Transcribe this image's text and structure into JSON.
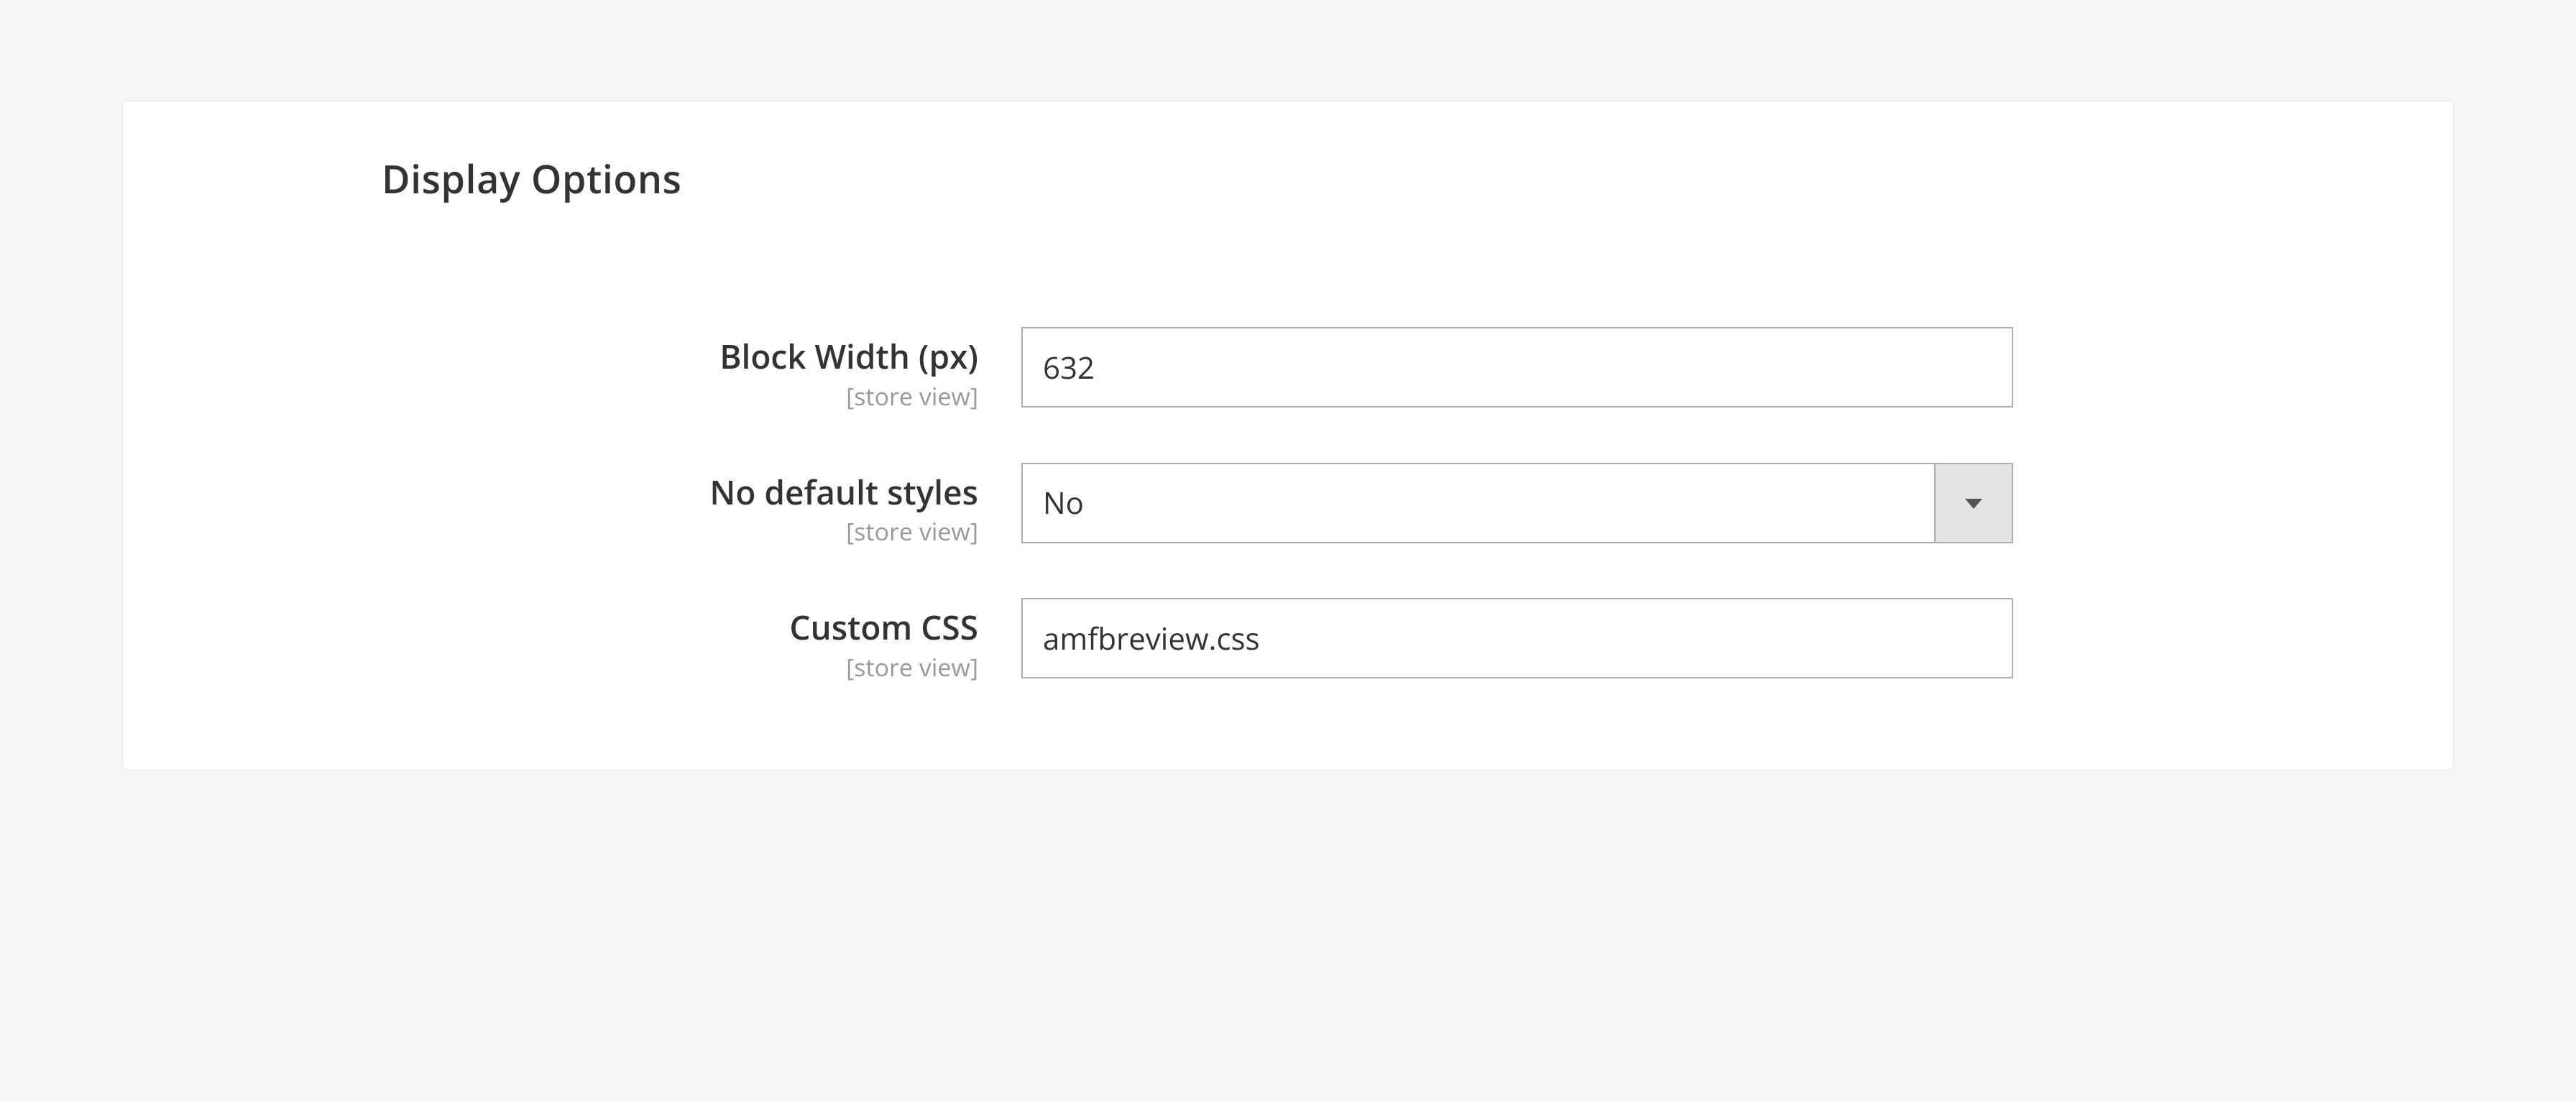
{
  "section": {
    "title": "Display Options"
  },
  "fields": {
    "block_width": {
      "label": "Block Width (px)",
      "scope": "[store view]",
      "value": "632"
    },
    "no_default_styles": {
      "label": "No default styles",
      "scope": "[store view]",
      "value": "No"
    },
    "custom_css": {
      "label": "Custom CSS",
      "scope": "[store view]",
      "value": "amfbreview.css"
    }
  }
}
